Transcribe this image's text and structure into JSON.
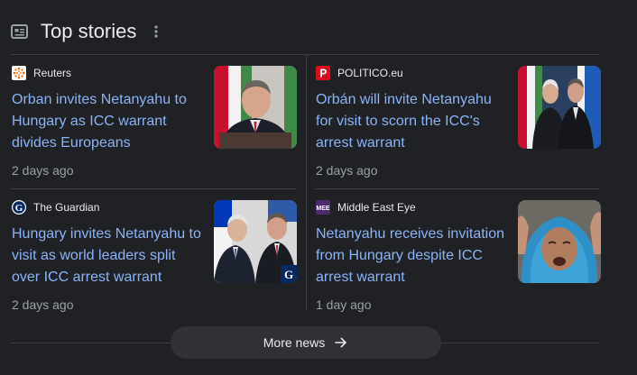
{
  "header": {
    "title": "Top stories",
    "icon": "newspaper-icon",
    "menu_icon": "more-vert-icon"
  },
  "stories": [
    {
      "source": "Reuters",
      "logo_icon": "reuters-logo-icon",
      "headline": "Orban invites Netanyahu to Hungary as ICC warrant divides Europeans",
      "age": "2 days ago",
      "thumbnail": "orban-podium-photo"
    },
    {
      "source": "POLITICO.eu",
      "logo_icon": "politico-logo-icon",
      "headline": "Orbán will invite Netanyahu for visit to scorn the ICC's arrest warrant",
      "age": "2 days ago",
      "thumbnail": "netanyahu-orban-flags-photo"
    },
    {
      "source": "The Guardian",
      "logo_icon": "guardian-logo-icon",
      "headline": "Hungary invites Netanyahu to visit as world leaders split over ICC arrest warrant",
      "age": "2 days ago",
      "thumbnail": "netanyahu-orban-guardian-photo"
    },
    {
      "source": "Middle East Eye",
      "logo_icon": "mee-logo-icon",
      "headline": "Netanyahu receives invitation from Hungary despite ICC arrest warrant",
      "age": "1 day ago",
      "thumbnail": "woman-headscarf-photo"
    }
  ],
  "more_news": {
    "label": "More news",
    "icon": "arrow-right-icon"
  },
  "colors": {
    "background": "#202124",
    "headline": "#8ab4f8",
    "text": "#e8eaed",
    "muted": "#9aa0a6",
    "divider": "#3c4043"
  }
}
